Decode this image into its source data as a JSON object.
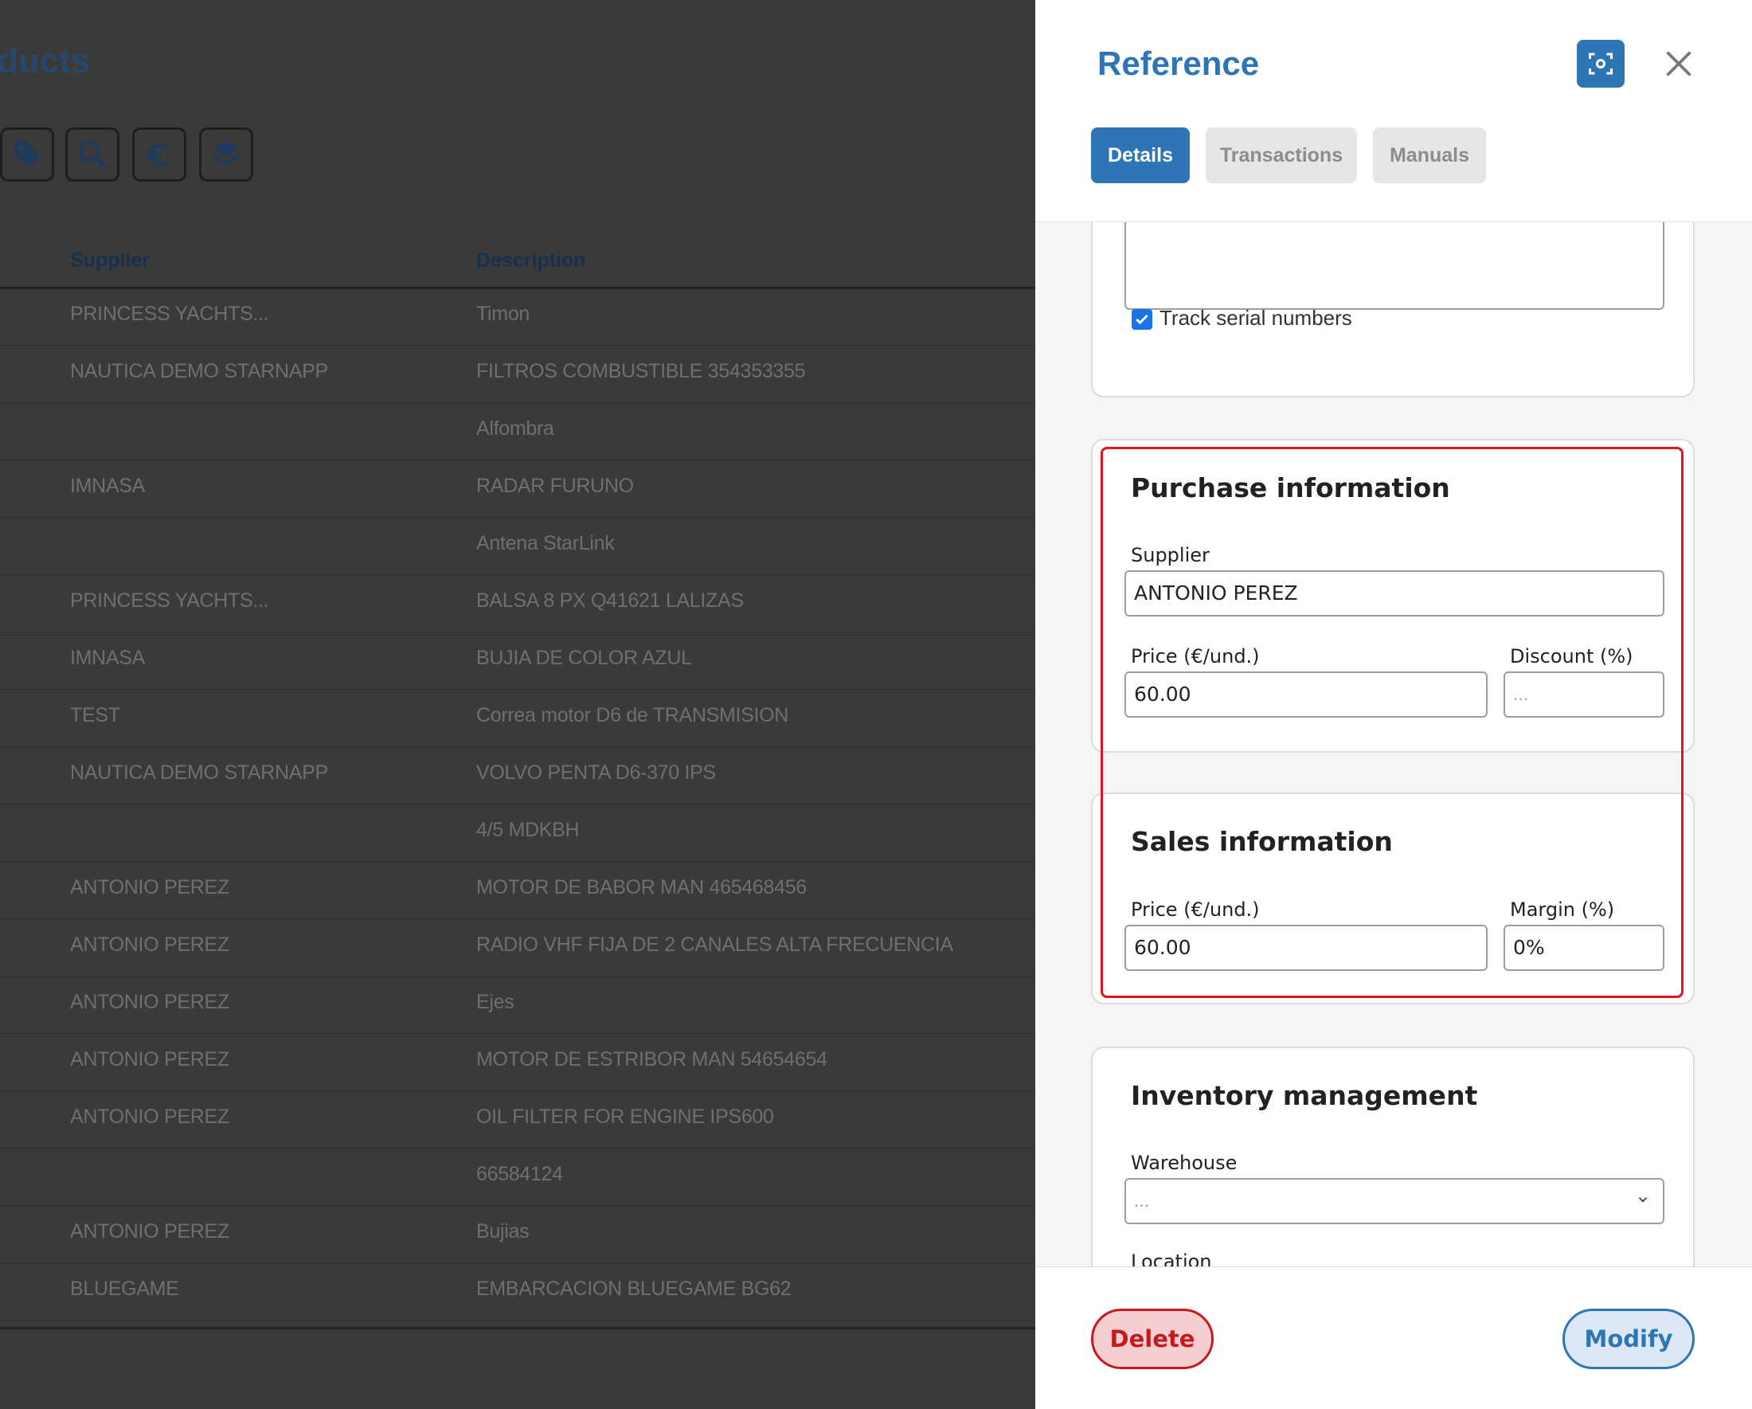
{
  "background": {
    "page_title": "ducts",
    "toolbar_icons": [
      "tag-icon",
      "search-icon",
      "euro-icon",
      "layers-icon"
    ],
    "columns": [
      "Supplier",
      "Description"
    ],
    "rows": [
      {
        "supplier": "PRINCESS YACHTS...",
        "description": "Timon"
      },
      {
        "supplier": "NAUTICA DEMO STARNAPP",
        "description": "FILTROS COMBUSTIBLE 354353355"
      },
      {
        "supplier": "",
        "description": "Alfombra"
      },
      {
        "supplier": "IMNASA",
        "description": "RADAR FURUNO"
      },
      {
        "supplier": "",
        "description": "Antena StarLink"
      },
      {
        "supplier": "PRINCESS YACHTS...",
        "description": "BALSA 8 PX Q41621 LALIZAS"
      },
      {
        "supplier": "IMNASA",
        "description": "BUJIA DE COLOR AZUL"
      },
      {
        "supplier": "TEST",
        "description": "Correa motor D6 de TRANSMISION"
      },
      {
        "supplier": "NAUTICA DEMO STARNAPP",
        "description": "VOLVO PENTA D6-370 IPS"
      },
      {
        "supplier": "",
        "description": "4/5 MDKBH"
      },
      {
        "supplier": "ANTONIO PEREZ",
        "description": "MOTOR DE BABOR MAN 465468456"
      },
      {
        "supplier": "ANTONIO PEREZ",
        "description": "RADIO VHF FIJA DE 2 CANALES ALTA FRECUENCIA"
      },
      {
        "supplier": "ANTONIO PEREZ",
        "description": "Ejes"
      },
      {
        "supplier": "ANTONIO PEREZ",
        "description": "MOTOR DE ESTRIBOR MAN 54654654"
      },
      {
        "supplier": "ANTONIO PEREZ",
        "description": "OIL FILTER FOR ENGINE IPS600"
      },
      {
        "supplier": "",
        "description": "66584124"
      },
      {
        "supplier": "ANTONIO PEREZ",
        "description": "Bujias"
      },
      {
        "supplier": "BLUEGAME",
        "description": "EMBARCACION BLUEGAME BG62"
      }
    ]
  },
  "drawer": {
    "title": "Reference",
    "scan_icon": "scan-icon",
    "close_icon": "close-icon",
    "tabs": [
      {
        "label": "Details",
        "active": true
      },
      {
        "label": "Transactions",
        "active": false
      },
      {
        "label": "Manuals",
        "active": false
      }
    ],
    "track_serial": {
      "label": "Track serial numbers",
      "checked": true
    },
    "purchase": {
      "heading": "Purchase information",
      "supplier_label": "Supplier",
      "supplier_value": "ANTONIO PEREZ",
      "price_label": "Price (€/und.)",
      "price_value": "60.00",
      "discount_label": "Discount (%)",
      "discount_placeholder": "..."
    },
    "sales": {
      "heading": "Sales information",
      "price_label": "Price (€/und.)",
      "price_value": "60.00",
      "margin_label": "Margin (%)",
      "margin_value": "0%"
    },
    "inventory": {
      "heading": "Inventory management",
      "warehouse_label": "Warehouse",
      "warehouse_placeholder": "...",
      "location_label": "Location"
    },
    "footer": {
      "delete_label": "Delete",
      "modify_label": "Modify"
    }
  },
  "colors": {
    "accent": "#2e75b6",
    "danger": "#c5191f",
    "highlight": "#e0141e",
    "overlay": "#3a3a3a"
  }
}
